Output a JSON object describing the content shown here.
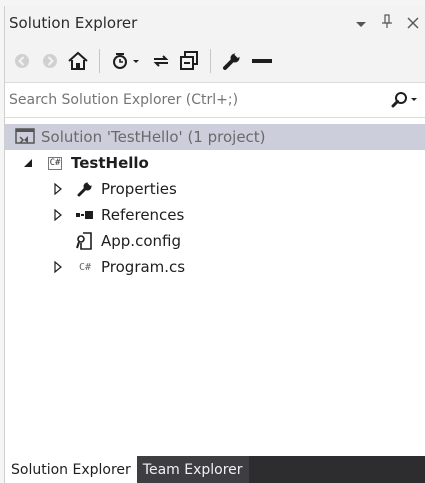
{
  "window": {
    "title": "Solution Explorer",
    "controls": {
      "dropdown_icon": "dropdown-arrow",
      "pin_icon": "pin",
      "close_icon": "close"
    }
  },
  "toolbar": {
    "buttons": [
      {
        "name": "back",
        "icon": "back-arrow"
      },
      {
        "name": "forward",
        "icon": "forward-arrow"
      },
      {
        "name": "home",
        "icon": "home"
      },
      {
        "name": "pending-changes-filter",
        "icon": "clock-dropdown"
      },
      {
        "name": "sync-with-active-document",
        "icon": "sync-arrows"
      },
      {
        "name": "collapse-all",
        "icon": "collapse"
      },
      {
        "name": "properties",
        "icon": "wrench"
      },
      {
        "name": "preview",
        "icon": "dash"
      }
    ]
  },
  "search": {
    "placeholder": "Search Solution Explorer (Ctrl+;)",
    "value": ""
  },
  "tree": {
    "solution": {
      "label": "Solution 'TestHello' (1 project)"
    },
    "project": {
      "label": "TestHello"
    },
    "items": [
      {
        "label": "Properties",
        "icon": "wrench",
        "expandable": true
      },
      {
        "label": "References",
        "icon": "references",
        "expandable": true
      },
      {
        "label": "App.config",
        "icon": "config-file",
        "expandable": false
      },
      {
        "label": "Program.cs",
        "icon": "csharp-file",
        "expandable": true
      }
    ]
  },
  "tabs": [
    {
      "label": "Solution Explorer",
      "active": true
    },
    {
      "label": "Team Explorer",
      "active": false
    }
  ],
  "colors": {
    "selection": "#cccedb",
    "tab_bar": "#2d2d30",
    "chrome": "#f3f3f3"
  }
}
